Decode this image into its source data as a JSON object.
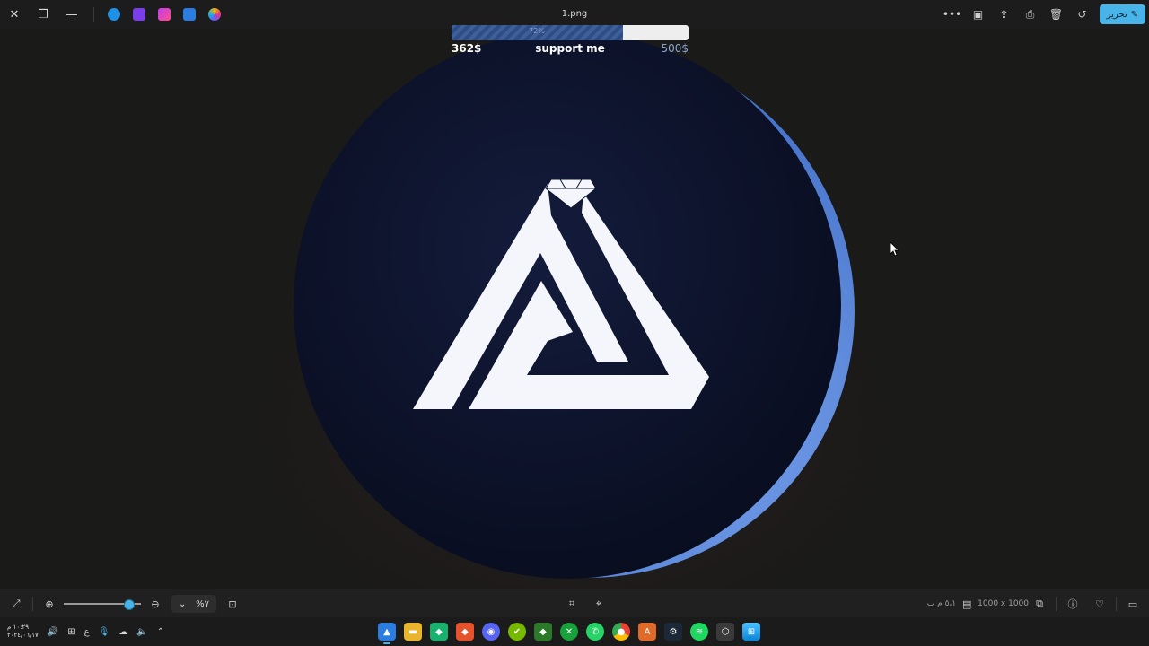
{
  "window": {
    "file_name": "1.png",
    "edit_button_label": "تحرير",
    "buttons": [
      "close-icon",
      "restore-icon",
      "minimize-icon"
    ],
    "app_shortcuts": [
      "onedrive-icon",
      "clipchamp-icon",
      "designer-icon",
      "photos-icon",
      "copilot-icon"
    ],
    "toolbar_icons": [
      "more-icon",
      "slideshow-icon",
      "share-icon",
      "print-icon",
      "delete-icon",
      "rotate-icon"
    ]
  },
  "overlay": {
    "current_amount": "362$",
    "goal_amount": "500$",
    "title": "support me",
    "progress_fraction": 0.724,
    "progress_percent_text": "72%",
    "colors": {
      "fill": "#3f5f9a",
      "track": "#eeeeee",
      "goal_text": "#8aa3d0"
    }
  },
  "image": {
    "description_icon": "diamond-triangle-logo-icon",
    "colors": {
      "circle": "#0d1430",
      "crescent": "#5a86d8",
      "logo": "#f4f6fb"
    }
  },
  "bottom_bar": {
    "zoom_percent": "%٧",
    "zoom_fraction": 0.84,
    "dimensions": "1000 x 1000",
    "file_size": "٥،١ م ب"
  },
  "taskbar": {
    "time": "١٠:٢٩ م",
    "date": "٢٠٢٤/٠٦/١٧",
    "lang": "ع",
    "accent": "#48b4e8"
  }
}
